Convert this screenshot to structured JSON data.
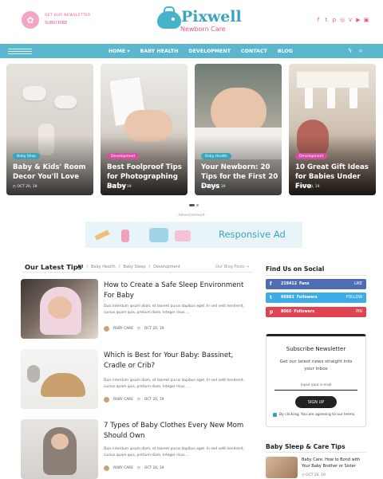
{
  "header": {
    "newsletter_title": "GET OUR NEWSLETTER",
    "newsletter_subscribe": "SUBSCRIBE",
    "logo_title": "Pixwell",
    "logo_subtitle": "Newborn Care",
    "social_icons": [
      "facebook-icon",
      "twitter-icon",
      "pinterest-icon",
      "instagram-icon",
      "vimeo-icon",
      "youtube-icon",
      "app-icon"
    ]
  },
  "nav": {
    "items": [
      "HOME ▾",
      "BABY HEALTH",
      "DEVELOPMENT",
      "CONTACT",
      "BLOG"
    ]
  },
  "slider": [
    {
      "badge": "Baby Shop",
      "title": "Baby & Kids' Room Decor You'll Love",
      "date": "OCT 20, 19",
      "badge_color": "#3aa4be"
    },
    {
      "badge": "Development",
      "title": "Best Foolproof Tips for Photographing Baby",
      "date": "OCT 20, 19",
      "badge_color": "#d44fa3"
    },
    {
      "badge": "Baby Health",
      "title": "Your Newborn: 20 Tips for the First 20 Days",
      "date": "OCT 20, 19",
      "badge_color": "#3aa4be"
    },
    {
      "badge": "Development",
      "title": "10 Great Gift Ideas for Babies Under Five",
      "date": "OCT 20, 19",
      "badge_color": "#d44fa3"
    }
  ],
  "ad": {
    "label": "- Advertisement -",
    "text": "Responsive Ad"
  },
  "latest_tips": {
    "title": "Our Latest Tips",
    "tabs": [
      "All",
      "/",
      "Baby Health",
      "/",
      "Baby Sleep",
      "/",
      "Development"
    ],
    "blog_posts_link": "Our Blog Posts →"
  },
  "articles": [
    {
      "title": "How to Create a Safe Sleep Environment For Baby",
      "excerpt": "Duis interdum ipsum diam, et laoreet purus dapibus eget. In sed velit hendrerit, cursus quam quis, pretium diam. Integer risus ...",
      "author": "RUBY CARE",
      "date": "OCT 20, 19"
    },
    {
      "title": "Which is Best for Your Baby: Bassinet, Cradle or Crib?",
      "excerpt": "Duis interdum ipsum diam, et laoreet purus dapibus eget. In sed velit hendrerit, cursus quam quis, pretium diam. Integer risus ...",
      "author": "RUBY CARE",
      "date": "OCT 20, 19"
    },
    {
      "title": "7 Types of Baby Clothes Every New Mom Should Own",
      "excerpt": "Duis interdum ipsum diam, et laoreet purus dapibus eget. In sed velit hendrerit, cursus quam quis, pretium diam. Integer risus ...",
      "author": "RUBY CARE",
      "date": "OCT 20, 19"
    }
  ],
  "sidebar": {
    "social_title": "Find Us on Social",
    "social": [
      {
        "icon": "f",
        "count": "219412",
        "label": "Fans",
        "action": "LIKE",
        "color": "#4f6db5"
      },
      {
        "icon": "t",
        "count": "66982",
        "label": "Followers",
        "action": "FOLLOW",
        "color": "#3dace8"
      },
      {
        "icon": "p",
        "count": "8060",
        "label": "Followers",
        "action": "PIN",
        "color": "#e04453"
      }
    ],
    "newsletter": {
      "title": "Subscribe Newsletter",
      "subtitle": "Get our latest news straight into your inbox",
      "placeholder": "Input your e-mail",
      "button": "SIGN UP",
      "consent": "By clicking, You are agreeing to our terms."
    },
    "care_tips_title": "Baby Sleep & Care Tips",
    "care_post": {
      "title": "Baby Care: How to Bond with Your Baby Brother or Sister",
      "date": "OCT 20, 19"
    }
  }
}
